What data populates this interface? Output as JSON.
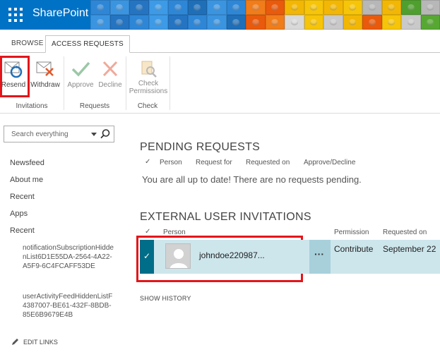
{
  "suite_bar": {
    "brand": "SharePoint",
    "lego_colors": [
      "#2e86d6",
      "#3b94e0",
      "#2474c2",
      "#3d9ae6",
      "#2e86d6",
      "#1f6fb8",
      "#3b94e0",
      "#2e86d6",
      "#f07c1a",
      "#e95a0c",
      "#f2b705",
      "#f6c409",
      "#f2b705",
      "#f6c409",
      "#b7b7b7",
      "#f2b705",
      "#4f9f2f",
      "#b7b7b7",
      "#3b94e0",
      "#2474c2",
      "#2e86d6",
      "#3d9ae6",
      "#2474c2",
      "#2e86d6",
      "#3b94e0",
      "#1f6fb8",
      "#e95a0c",
      "#f07c1a",
      "#d9d9d9",
      "#f6c409",
      "#c9c9c9",
      "#f2b705",
      "#e95a0c",
      "#f6c409",
      "#c9c9c9",
      "#56a832"
    ]
  },
  "ribbon": {
    "tabs": [
      "BROWSE",
      "ACCESS REQUESTS"
    ],
    "buttons": {
      "resend": "Resend",
      "withdraw": "Withdraw",
      "approve": "Approve",
      "decline": "Decline",
      "check_permissions_line1": "Check",
      "check_permissions_line2": "Permissions"
    },
    "groups": [
      "Invitations",
      "Requests",
      "Check"
    ]
  },
  "left_nav": {
    "search_placeholder": "Search everything",
    "items": [
      "Newsfeed",
      "About me",
      "Recent",
      "Apps",
      "Recent"
    ],
    "sub_items": [
      "notificationSubscriptionHiddenList6D1E55DA-2564-4A22-A5F9-6C4FCAFF53DE",
      "userActivityFeedHiddenListF4387007-BE61-432F-8BDB-85E6B9679E4B"
    ],
    "edit_links": "EDIT LINKS"
  },
  "pending": {
    "title": "PENDING REQUESTS",
    "columns": [
      "Person",
      "Request for",
      "Requested on",
      "Approve/Decline"
    ],
    "empty_message": "You are all up to date! There are no requests pending."
  },
  "external": {
    "title": "EXTERNAL USER INVITATIONS",
    "columns": [
      "Person",
      "Permission",
      "Requested on"
    ],
    "rows": [
      {
        "person": "johndoe220987...",
        "permission": "Contribute",
        "requested_on": "September 22"
      }
    ],
    "show_history": "SHOW HISTORY"
  },
  "colors": {
    "suite_bar": "#0072c6",
    "highlight": "#e3151a",
    "selected_row": "#cde6ec",
    "row_check": "#006d89"
  }
}
